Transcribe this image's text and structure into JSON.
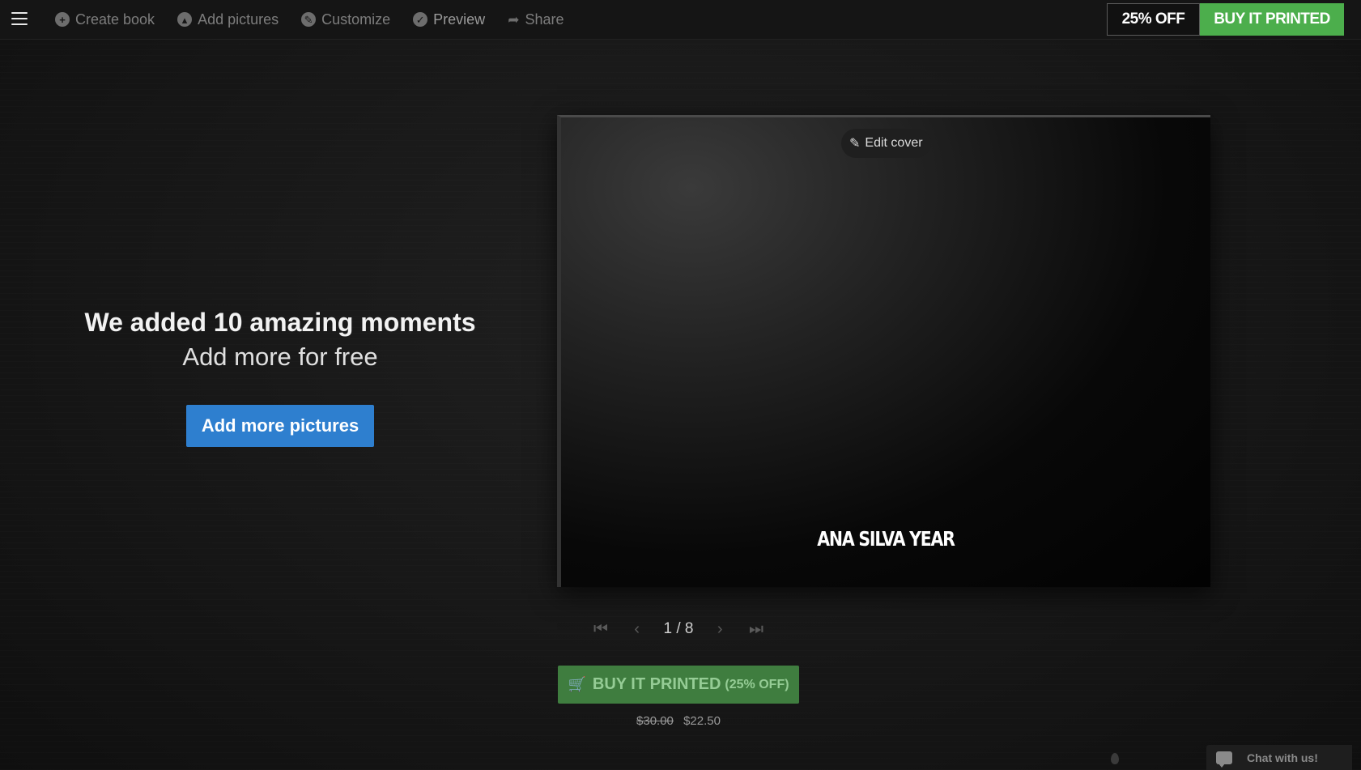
{
  "nav": {
    "items": [
      {
        "label": "Create book",
        "icon": "plus-circle-icon",
        "glyph": "+"
      },
      {
        "label": "Add pictures",
        "icon": "picture-circle-icon",
        "glyph": "▴"
      },
      {
        "label": "Customize",
        "icon": "brush-circle-icon",
        "glyph": "✎"
      },
      {
        "label": "Preview",
        "icon": "check-circle-icon",
        "glyph": "✓"
      },
      {
        "label": "Share",
        "icon": "share-arrow-icon",
        "glyph": "➦"
      }
    ]
  },
  "offer": {
    "badge": "25% OFF",
    "buy_label": "BUY IT PRINTED"
  },
  "message": {
    "title": "We added 10 amazing  moments",
    "subtitle": "Add more for free",
    "button": "Add more pictures"
  },
  "book": {
    "edit_cover": "Edit cover",
    "title": "ANA SILVA YEAR"
  },
  "pager": {
    "count": "1 / 8"
  },
  "purchase": {
    "button_main": "BUY IT PRINTED",
    "button_discount": "(25% OFF)",
    "old_price": "$30.00",
    "new_price": "$22.50"
  },
  "chat": {
    "label": "Chat with us!"
  },
  "colors": {
    "accent_blue": "#2e7fcf",
    "buy_green": "#4cae4c",
    "buy_green_dark": "#3f7d3f"
  }
}
